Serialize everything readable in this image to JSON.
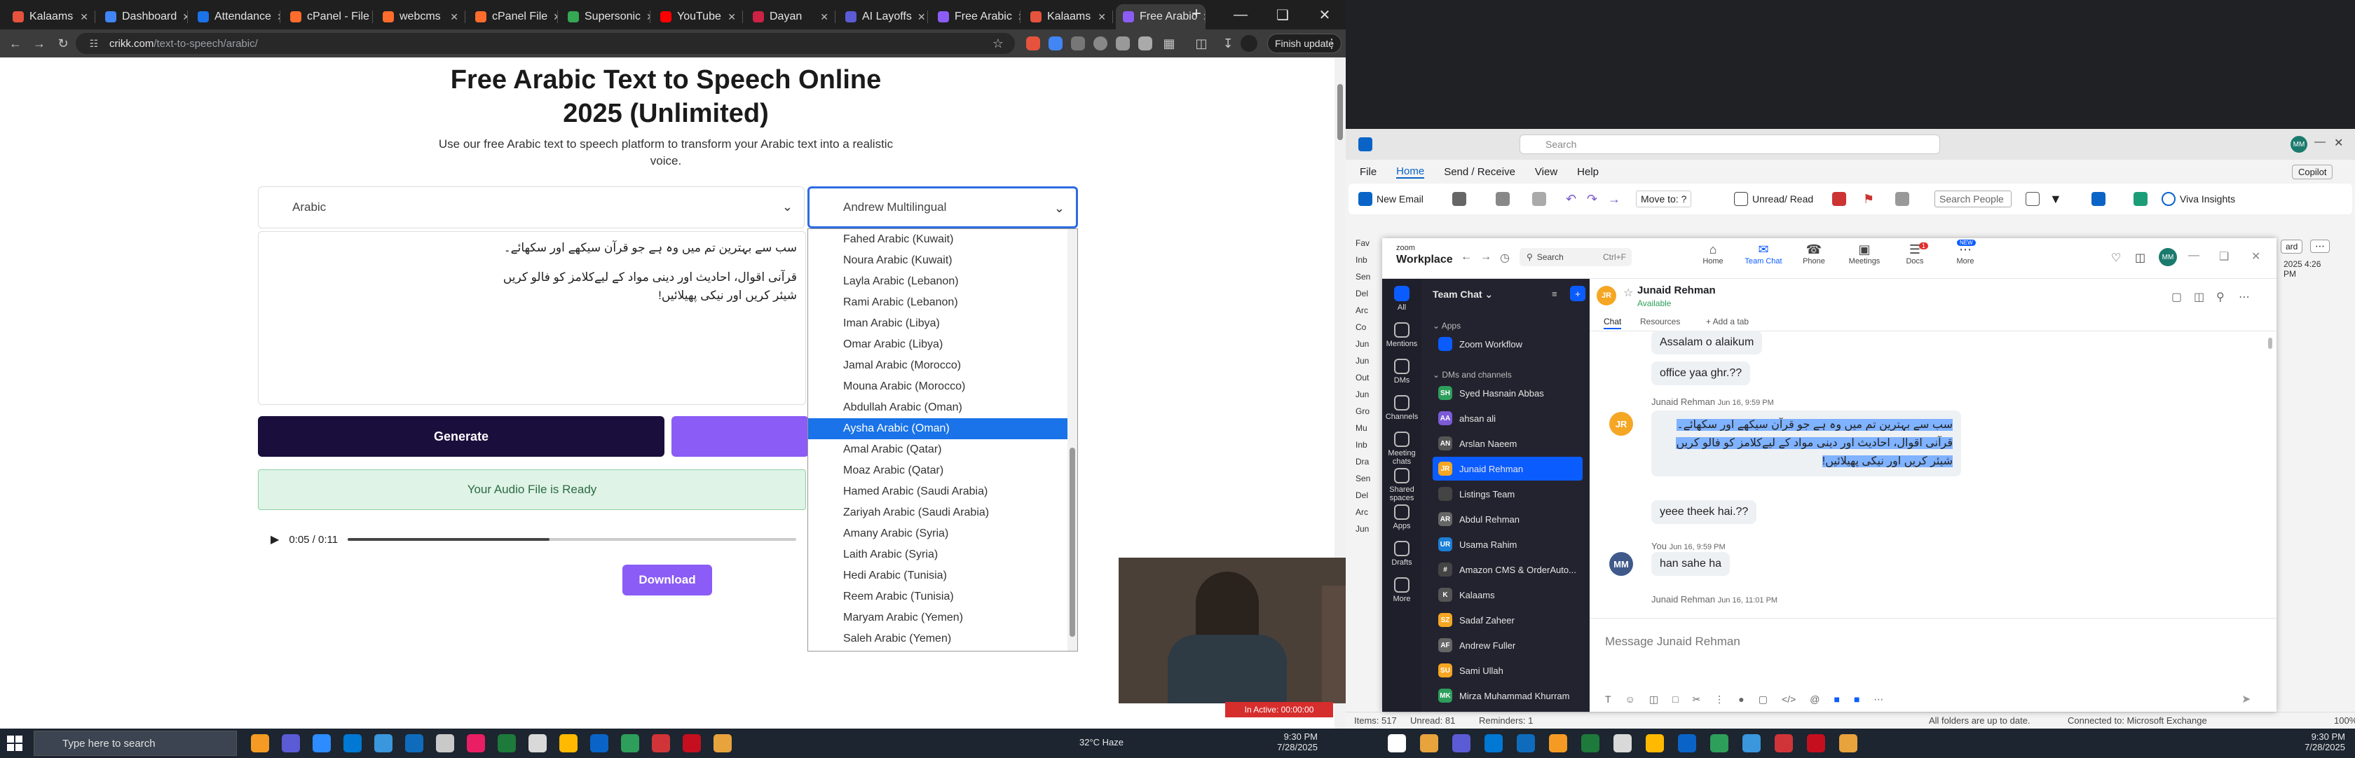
{
  "browser": {
    "tabs": [
      {
        "label": "Kalaams",
        "color": "#e5533d"
      },
      {
        "label": "Dashboard",
        "color": "#4285f4"
      },
      {
        "label": "Attendance",
        "color": "#1a73e8"
      },
      {
        "label": "cPanel - File",
        "color": "#ff6c2c"
      },
      {
        "label": "webcms",
        "color": "#ff6c2c"
      },
      {
        "label": "cPanel File",
        "color": "#ff6c2c"
      },
      {
        "label": "Supersonic",
        "color": "#34a853"
      },
      {
        "label": "YouTube",
        "color": "#ff0000"
      },
      {
        "label": "Dayan",
        "color": "#cc2244"
      },
      {
        "label": "AI Layoffs",
        "color": "#5b5bd6"
      },
      {
        "label": "Free Arabic",
        "color": "#8b5cf6"
      },
      {
        "label": "Kalaams",
        "color": "#e5533d"
      },
      {
        "label": "Free Arabic",
        "color": "#8b5cf6"
      }
    ],
    "active_tab_index": 12,
    "url_host": "crikk.com",
    "url_path": "/text-to-speech/arabic/",
    "finish_update_label": "Finish update"
  },
  "page": {
    "title_line1": "Free Arabic Text to Speech Online",
    "title_line2": "2025 (Unlimited)",
    "subtitle_line1": "Use our free Arabic text to speech platform to transform your Arabic text into a realistic",
    "subtitle_line2": "voice.",
    "language_select": "Arabic",
    "voice_select": "Andrew Multilingual",
    "text_line1": "سب سے بہترین تم میں وہ ہے جو قرآن سیکھے اور سکھائے۔",
    "text_line2": "قرآنی اقوال، احادیث اور دینی مواد کے لیےکلامز کو فالو کریں",
    "text_line3": "شیئر کریں اور نیکی پھیلائیں!",
    "generate_label": "Generate",
    "ready_label": "Your Audio File is Ready",
    "player_time": "0:05 / 0:11",
    "player_progress": 0.45,
    "download_label": "Download",
    "voice_options": [
      "Fahed Arabic (Kuwait)",
      "Noura Arabic (Kuwait)",
      "Layla Arabic (Lebanon)",
      "Rami Arabic (Lebanon)",
      "Iman Arabic (Libya)",
      "Omar Arabic (Libya)",
      "Jamal Arabic (Morocco)",
      "Mouna Arabic (Morocco)",
      "Abdullah Arabic (Oman)",
      "Aysha Arabic (Oman)",
      "Amal Arabic (Qatar)",
      "Moaz Arabic (Qatar)",
      "Hamed Arabic (Saudi Arabia)",
      "Zariyah Arabic (Saudi Arabia)",
      "Amany Arabic (Syria)",
      "Laith Arabic (Syria)",
      "Hedi Arabic (Tunisia)",
      "Reem Arabic (Tunisia)",
      "Maryam Arabic (Yemen)",
      "Saleh Arabic (Yemen)"
    ],
    "highlighted_option": 9
  },
  "outlook": {
    "search_placeholder": "Search",
    "menu": [
      "File",
      "Home",
      "Send / Receive",
      "View",
      "Help"
    ],
    "copilot_label": "Copilot",
    "ribbon": {
      "new_email": "New Email",
      "move_to": "Move to: ?",
      "unread_read": "Unread/ Read",
      "search_people": "Search People",
      "viva": "Viva Insights"
    },
    "status": {
      "items": "Items: 517",
      "unread": "Unread: 81",
      "reminders": "Reminders: 1",
      "folders": "All folders are up to date.",
      "connected": "Connected to: Microsoft Exchange",
      "zoom": "100%"
    },
    "left_labels": [
      "Fav",
      "Inb",
      "Sen",
      "Del",
      "Arc",
      "Co",
      "Jun",
      "Jun",
      "Out",
      "Jun",
      "Gro",
      "Mu",
      "Inb",
      "Dra",
      "Sen",
      "Del",
      "Arc",
      "Jun"
    ],
    "side_date": "2025 4:26 PM"
  },
  "zoom": {
    "brand_small": "zoom",
    "brand": "Workplace",
    "search_label": "Search",
    "search_shortcut": "Ctrl+F",
    "nav": [
      {
        "label": "Home"
      },
      {
        "label": "Team Chat"
      },
      {
        "label": "Phone"
      },
      {
        "label": "Meetings"
      },
      {
        "label": "Docs"
      },
      {
        "label": "More"
      }
    ],
    "new_badge": "NEW",
    "docs_badge": "1",
    "profile_initials": "MM",
    "rail": [
      "All",
      "Mentions",
      "DMs",
      "Channels",
      "Meeting chats",
      "Shared spaces",
      "Apps",
      "Drafts",
      "More"
    ],
    "list_header": "Team Chat",
    "sections": {
      "apps": "Apps",
      "dms": "DMs and channels"
    },
    "contacts": [
      {
        "name": "Zoom Workflow",
        "initials": "",
        "color": "#0b5cff"
      },
      {
        "name": "Syed Hasnain Abbas",
        "initials": "SH",
        "color": "#2e9e5b"
      },
      {
        "name": "ahsan ali",
        "initials": "AA",
        "color": "#7b5bd6"
      },
      {
        "name": "Arslan Naeem",
        "initials": "AN",
        "color": "#555"
      },
      {
        "name": "Junaid Rehman",
        "initials": "JR",
        "color": "#f5a623"
      },
      {
        "name": "Listings Team",
        "initials": "",
        "color": "#444"
      },
      {
        "name": "Abdul Rehman",
        "initials": "AR",
        "color": "#666"
      },
      {
        "name": "Usama Rahim",
        "initials": "UR",
        "color": "#1b7fd6"
      },
      {
        "name": "Amazon CMS & OrderAuto...",
        "initials": "#",
        "color": "#444"
      },
      {
        "name": "Kalaams",
        "initials": "K",
        "color": "#555"
      },
      {
        "name": "Sadaf Zaheer",
        "initials": "SZ",
        "color": "#f5a623"
      },
      {
        "name": "Andrew Fuller",
        "initials": "AF",
        "color": "#666"
      },
      {
        "name": "Sami Ullah",
        "initials": "SU",
        "color": "#f5a623"
      },
      {
        "name": "Mirza Muhammad Khurram",
        "initials": "MK",
        "color": "#2e9e5b"
      }
    ],
    "active_contact": 4,
    "chat": {
      "name": "Junaid Rehman",
      "status": "Available",
      "tabs": [
        "Chat",
        "Resources",
        "+ Add a tab"
      ],
      "messages": {
        "m1": "Assalam o alaikum",
        "m2": "office yaa ghr.??",
        "meta1": "Junaid Rehman",
        "time1": "Jun 16, 9:59 PM",
        "urdu1": "سب سے بہترین تم میں وہ ہے جو قرآن سیکھے اور سکھائے۔",
        "urdu2": "قرآنی اقوال، احادیث اور دینی مواد کے لیےکلامز کو فالو کریں",
        "urdu3": "شیئر کریں اور نیکی پھیلائیں!",
        "m3": "yeee theek hai.??",
        "meta2": "You",
        "time2": "Jun 16, 9:59 PM",
        "m4": "han sahe ha",
        "meta3": "Junaid Rehman",
        "time3": "Jun 16, 11:01 PM"
      },
      "compose_placeholder": "Message Junaid Rehman",
      "sender_initials": "JR",
      "you_initials": "MM"
    },
    "inactive_label": "In Active: 00:00:00"
  },
  "taskbar": {
    "search_placeholder": "Type here to search",
    "weather": "32°C  Haze",
    "time1": "9:30 PM",
    "date1": "7/28/2025",
    "time2": "9:30 PM",
    "date2": "7/28/2025"
  }
}
